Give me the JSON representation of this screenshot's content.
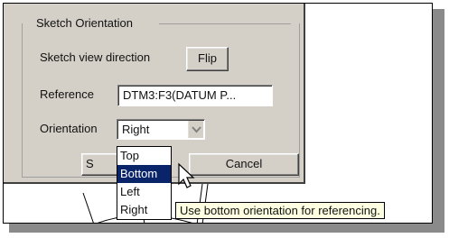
{
  "group": {
    "title": "Sketch Orientation"
  },
  "view_direction": {
    "label": "Sketch view direction",
    "button": "Flip"
  },
  "reference": {
    "label": "Reference",
    "value": "DTM3:F3(DATUM P..."
  },
  "orientation": {
    "label": "Orientation",
    "selected": "Right",
    "options": [
      "Top",
      "Bottom",
      "Left",
      "Right"
    ],
    "highlighted": "Bottom"
  },
  "buttons": {
    "sketch_partial": "S",
    "cancel": "Cancel"
  },
  "tooltip": "Use bottom orientation for referencing.",
  "colors": {
    "dialog_bg": "#d4d0c8",
    "selection": "#0a246a",
    "tooltip_bg": "#ffffe1"
  }
}
